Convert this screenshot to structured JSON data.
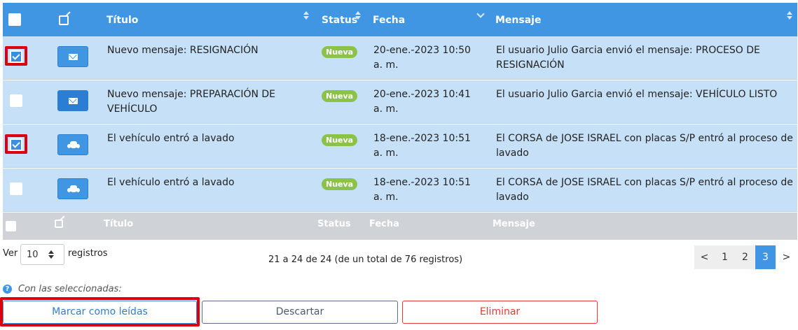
{
  "table": {
    "headers": {
      "titulo": "Título",
      "status": "Status",
      "fecha": "Fecha",
      "mensaje": "Mensaje"
    },
    "rows": [
      {
        "checked": true,
        "icon": "envelope-icon",
        "titulo": [
          "Nuevo mensaje: RESIGNACIÓN"
        ],
        "status": "Nueva",
        "fecha": [
          "20-ene.-2023 10:50",
          "a. m."
        ],
        "mensaje": [
          "El usuario Julio Garcia envió el mensaje: PROCESO DE",
          "RESIGNACIÓN"
        ]
      },
      {
        "checked": false,
        "icon": "envelope-icon",
        "titulo": [
          "Nuevo mensaje: PREPARACIÓN DE",
          "VEHÍCULO"
        ],
        "status": "Nueva",
        "fecha": [
          "20-ene.-2023 10:41",
          "a. m."
        ],
        "mensaje": [
          "El usuario Julio Garcia envió el mensaje: VEHÍCULO LISTO"
        ]
      },
      {
        "checked": true,
        "icon": "car-icon",
        "titulo": [
          "El vehículo entró a lavado"
        ],
        "status": "Nueva",
        "fecha": [
          "18-ene.-2023 10:51",
          "a. m."
        ],
        "mensaje": [
          "El CORSA de JOSE ISRAEL con placas S/P entró al proceso de",
          "lavado"
        ]
      },
      {
        "checked": false,
        "icon": "car-icon",
        "titulo": [
          "El vehículo entró a lavado"
        ],
        "status": "Nueva",
        "fecha": [
          "18-ene.-2023 10:51",
          "a. m."
        ],
        "mensaje": [
          "El CORSA de JOSE ISRAEL con placas S/P entró al proceso de",
          "lavado"
        ]
      }
    ],
    "footer": {
      "titulo": "Título",
      "status": "Status",
      "fecha": "Fecha",
      "mensaje": "Mensaje"
    }
  },
  "length_menu": {
    "prefix": "Ver",
    "value": "10",
    "suffix": "registros"
  },
  "info": "21 a 24 de 24 (de un total de 76 registros)",
  "pagination": {
    "prev": "<",
    "pages": [
      "1",
      "2",
      "3"
    ],
    "active": "3",
    "next": ">"
  },
  "bulk": {
    "help_icon": "?",
    "label": "Con las seleccionadas:",
    "mark_read": "Marcar como leídas",
    "discard": "Descartar",
    "delete": "Eliminar"
  },
  "colors": {
    "header": "#4196e3",
    "row": "#c6e0f7",
    "badge": "#8bc34a",
    "highlight": "#d9000f"
  }
}
